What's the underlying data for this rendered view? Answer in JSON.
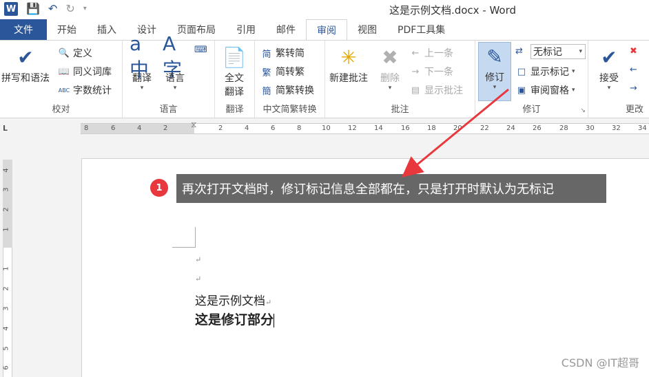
{
  "app": {
    "title": "这是示例文档.docx - Word",
    "logo": "W"
  },
  "qat": {
    "save_icon": "save-icon",
    "undo_icon": "undo-icon",
    "redo_icon": "redo-icon",
    "customize_icon": "customize-qat-icon"
  },
  "tabs": [
    {
      "label": "文件"
    },
    {
      "label": "开始"
    },
    {
      "label": "插入"
    },
    {
      "label": "设计"
    },
    {
      "label": "页面布局"
    },
    {
      "label": "引用"
    },
    {
      "label": "邮件"
    },
    {
      "label": "审阅"
    },
    {
      "label": "视图"
    },
    {
      "label": "PDF工具集"
    }
  ],
  "ribbon": {
    "proofing": {
      "label": "校对",
      "spell": "拼写和语法",
      "define": "定义",
      "thesaurus": "同义词库",
      "wordcount": "字数统计"
    },
    "language": {
      "label": "语言",
      "translate": "翻译",
      "language": "语言"
    },
    "translation": {
      "label": "翻译",
      "fulltext_l1": "全文",
      "fulltext_l2": "翻译"
    },
    "chinese": {
      "label": "中文简繁转换",
      "t2s": "繁转简",
      "s2t": "简转繁",
      "convert": "简繁转换"
    },
    "comments": {
      "label": "批注",
      "new": "新建批注",
      "delete": "删除",
      "prev": "上一条",
      "next": "下一条",
      "show": "显示批注"
    },
    "tracking": {
      "label": "修订",
      "track": "修订",
      "markup_select": "无标记",
      "show_markup": "显示标记",
      "pane": "审阅窗格"
    },
    "changes": {
      "label": "更改",
      "accept": "接受"
    }
  },
  "ruler": {
    "ticks": [
      "8",
      "6",
      "4",
      "2",
      "2",
      "4",
      "6",
      "8",
      "10",
      "12",
      "14",
      "16",
      "18",
      "20",
      "22",
      "24",
      "26",
      "28",
      "30",
      "32",
      "34"
    ],
    "corner": "L"
  },
  "vruler": {
    "ticks": [
      "4",
      "3",
      "2",
      "1",
      "1",
      "2",
      "3",
      "4",
      "5",
      "6"
    ]
  },
  "callout": {
    "number": "1",
    "text": "再次打开文档时，修订标记信息全部都在，只是打开时默认为无标记"
  },
  "document": {
    "line1": "这是示例文档",
    "line2": "这是修订部分",
    "para_mark": "↵"
  },
  "colors": {
    "accent": "#2b579a",
    "badge": "#e8383d",
    "arrow": "#e8383d",
    "callout_bg": "#676767"
  },
  "watermark": "CSDN @IT超哥"
}
